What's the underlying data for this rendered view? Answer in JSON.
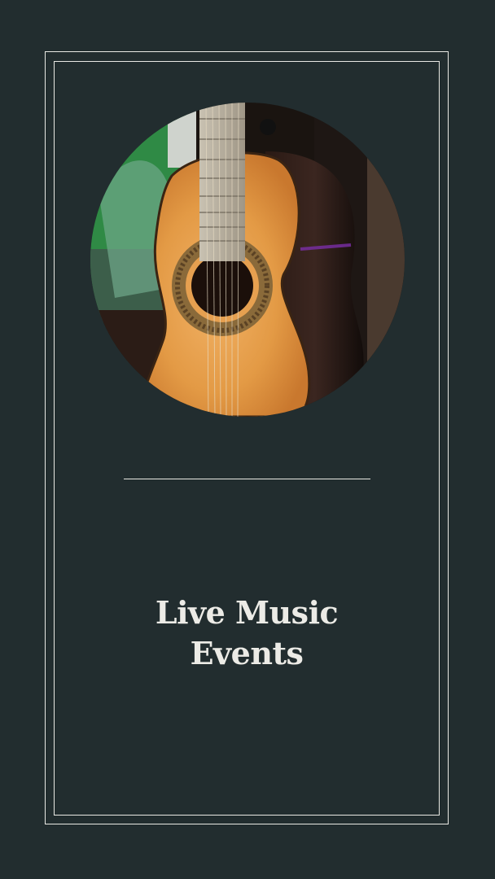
{
  "poster": {
    "title_line1": "Live Music",
    "title_line2": "Events",
    "photo_subject": "classical-guitar-photo",
    "colors": {
      "background": "#222d2f",
      "frame": "#e9e9e4",
      "title": "#ecebe6"
    }
  }
}
